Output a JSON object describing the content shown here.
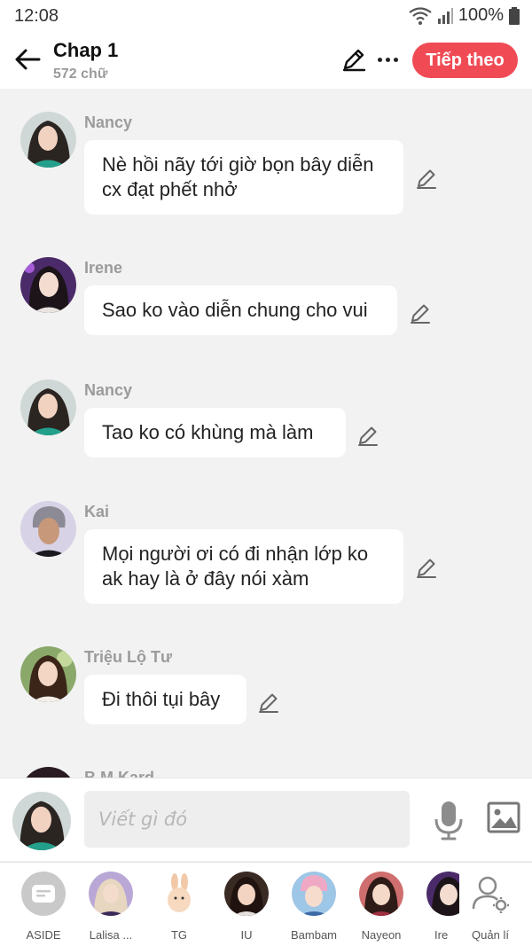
{
  "status": {
    "time": "12:08",
    "battery": "100%"
  },
  "header": {
    "title": "Chap 1",
    "subtitle": "572 chữ",
    "next_label": "Tiếp theo"
  },
  "messages": [
    {
      "sender": "Nancy",
      "text": "Nè hồi nãy tới giờ bọn bây diễn cx đạt phết nhở"
    },
    {
      "sender": "Irene",
      "text": "Sao ko vào diễn chung cho vui"
    },
    {
      "sender": "Nancy",
      "text": "Tao ko có khùng mà làm"
    },
    {
      "sender": "Kai",
      "text": "Mọi người ơi có đi nhận lớp ko ak hay là ở đây nói xàm"
    },
    {
      "sender": "Triệu Lộ Tư",
      "text": "Đi thôi tụi bây"
    },
    {
      "sender": "B.M.Kard",
      "text": ""
    }
  ],
  "composer": {
    "placeholder": "Viết gì đó"
  },
  "characters": [
    {
      "label": "ASIDE"
    },
    {
      "label": "Lalisa ..."
    },
    {
      "label": "TG"
    },
    {
      "label": "IU"
    },
    {
      "label": "Bambam"
    },
    {
      "label": "Nayeon"
    },
    {
      "label": "Ire"
    },
    {
      "label": "Quản lí"
    }
  ],
  "colors": {
    "accent": "#f04b55",
    "background": "#f2f2f2",
    "bubble": "#ffffff",
    "sender": "#9b9b9b"
  }
}
